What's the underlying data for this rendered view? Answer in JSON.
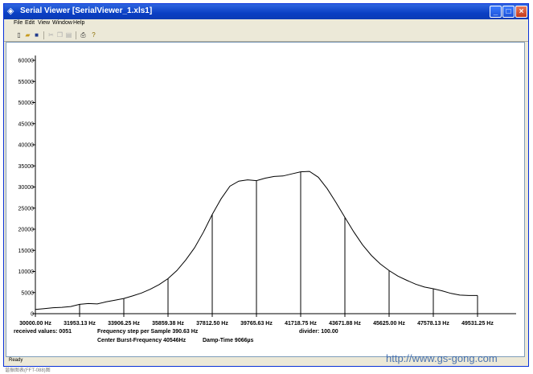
{
  "window": {
    "title": "Serial Viewer   [SerialViewer_1.xls1]",
    "minimize_glyph": "_",
    "maximize_glyph": "□",
    "close_glyph": "×"
  },
  "menu": [
    "File",
    "Edit",
    "View",
    "Window",
    "Help"
  ],
  "toolbar": {
    "icons": [
      "new-file-icon",
      "open-folder-icon",
      "save-disk-icon",
      "cut-scissors-icon",
      "copy-icon",
      "paste-icon",
      "print-icon",
      "help-icon"
    ]
  },
  "status": {
    "text": "Ready"
  },
  "info": {
    "received": "received values: 0051",
    "freq_step": "Frequency step per Sample 390.63 Hz",
    "center_burst": "Center Burst-Frequency 40546Hz",
    "damp_time": "Damp-Time 9066µs",
    "divider": "divider: 100.00"
  },
  "caption": "谐振图表(FFT-088)图",
  "watermark": "http://www.gs-gong.com",
  "chart_data": {
    "type": "area",
    "title": "",
    "xlabel": "",
    "ylabel": "",
    "ylim": [
      0,
      60000
    ],
    "y_ticks": [
      0,
      5000,
      10000,
      15000,
      20000,
      25000,
      30000,
      35000,
      40000,
      45000,
      50000,
      55000,
      60000
    ],
    "y_tick_labels": [
      "0",
      "5000",
      "10000",
      "15000",
      "20000",
      "25000",
      "30000",
      "35000",
      "40000",
      "45000",
      "50000",
      "55000",
      "60000"
    ],
    "x_tick_labels": [
      "30000.00 Hz",
      "31953.13 Hz",
      "33906.25 Hz",
      "35859.38 Hz",
      "37812.50 Hz",
      "39765.63 Hz",
      "41718.75 Hz",
      "43671.88 Hz",
      "45625.00 Hz",
      "47578.13 Hz",
      "49531.25 Hz"
    ],
    "x_tick_values": [
      30000.0,
      31953.13,
      33906.25,
      35859.38,
      37812.5,
      39765.63,
      41718.75,
      43671.88,
      45625.0,
      47578.13,
      49531.25
    ],
    "xlim": [
      30000.0,
      49531.25
    ],
    "grid": false,
    "series": [
      {
        "x": [
          30000.0,
          30390.63,
          30781.25,
          31171.88,
          31562.5,
          31953.13,
          32343.75,
          32734.38,
          33125.0,
          33515.63,
          33906.25,
          34296.88,
          34687.5,
          35078.13,
          35468.75,
          35859.38,
          36250.0,
          36640.63,
          37031.25,
          37421.88,
          37812.5,
          38203.13,
          38593.75,
          38984.38,
          39375.0,
          39765.63,
          40156.25,
          40546.88,
          40937.5,
          41328.13,
          41718.75,
          42109.38,
          42500.0,
          42890.63,
          43281.25,
          43671.88,
          44062.5,
          44453.13,
          44843.75,
          45234.38,
          45625.0,
          46015.63,
          46406.25,
          46796.88,
          47187.5,
          47578.13,
          47968.75,
          48359.38,
          48750.0,
          49140.63,
          49531.25
        ],
        "values": [
          1000,
          1200,
          1400,
          1500,
          1700,
          2200,
          2400,
          2300,
          2800,
          3200,
          3600,
          4200,
          4900,
          5800,
          6900,
          8300,
          10200,
          12700,
          15600,
          19300,
          23500,
          27200,
          30200,
          31400,
          31700,
          31500,
          32100,
          32500,
          32600,
          33100,
          33600,
          33700,
          32300,
          29600,
          26300,
          22800,
          19400,
          16300,
          13800,
          11800,
          10200,
          8900,
          7900,
          7000,
          6300,
          5900,
          5400,
          4800,
          4400,
          4300,
          4300
        ]
      }
    ]
  }
}
